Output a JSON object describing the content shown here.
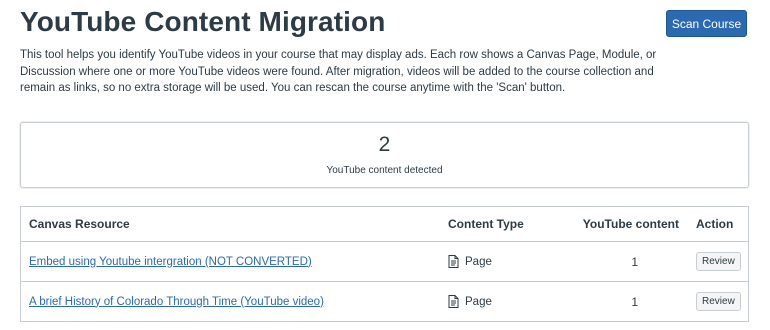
{
  "header": {
    "title": "YouTube Content Migration",
    "scan_button_label": "Scan Course",
    "description": "This tool helps you identify YouTube videos in your course that may display ads. Each row shows a Canvas Page, Module, or Discussion where one or more YouTube videos were found. After migration, videos will be added to the course collection and remain as links, so no extra storage will be used. You can rescan the course anytime with the 'Scan' button."
  },
  "summary": {
    "count": "2",
    "label": "YouTube content detected"
  },
  "table": {
    "columns": {
      "resource": "Canvas Resource",
      "type": "Content Type",
      "youtube": "YouTube content",
      "action": "Action"
    },
    "rows": [
      {
        "resource": "Embed using Youtube intergration (NOT CONVERTED)",
        "type_icon": "page-icon",
        "type": "Page",
        "youtube": "1",
        "action": "Review"
      },
      {
        "resource": "A brief History of Colorado Through Time (YouTube video)",
        "type_icon": "page-icon",
        "type": "Page",
        "youtube": "1",
        "action": "Review"
      }
    ]
  },
  "colors": {
    "primary": "#2b6ab1",
    "text": "#2d3b45",
    "border": "#c7cdd1"
  }
}
